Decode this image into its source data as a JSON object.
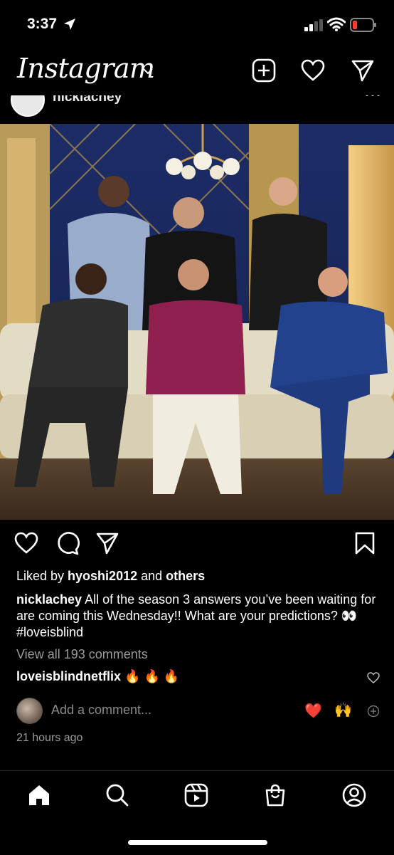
{
  "status_bar": {
    "time": "3:37"
  },
  "header": {
    "logo": "Instagram"
  },
  "post": {
    "author": "nicklachey",
    "likes": {
      "prefix": "Liked by ",
      "user": "hyoshi2012",
      "middle": " and ",
      "others": "others"
    },
    "caption": {
      "user": "nicklachey",
      "text": " All of the season 3 answers you’ve been waiting for are coming this Wednesday!! What are your predictions? 👀 #loveisblind"
    },
    "view_comments": "View all 193 comments",
    "top_comment": {
      "user": "loveisblindnetflix",
      "text": " 🔥 🔥 🔥"
    },
    "add_comment_placeholder": "Add a comment...",
    "quick_reactions": [
      "❤️",
      "🙌"
    ],
    "timestamp": "21 hours ago"
  },
  "icons": {
    "header": [
      "new-post-icon",
      "heart-icon",
      "direct-message-icon"
    ],
    "actions": [
      "like-icon",
      "comment-icon",
      "share-icon",
      "save-icon"
    ],
    "tabs": [
      "home-icon",
      "search-icon",
      "reels-icon",
      "shop-icon",
      "profile-icon"
    ]
  },
  "colors": {
    "background": "#000000",
    "text": "#ffffff",
    "muted": "#9a9a9a",
    "battery_low": "#ff3b30"
  }
}
